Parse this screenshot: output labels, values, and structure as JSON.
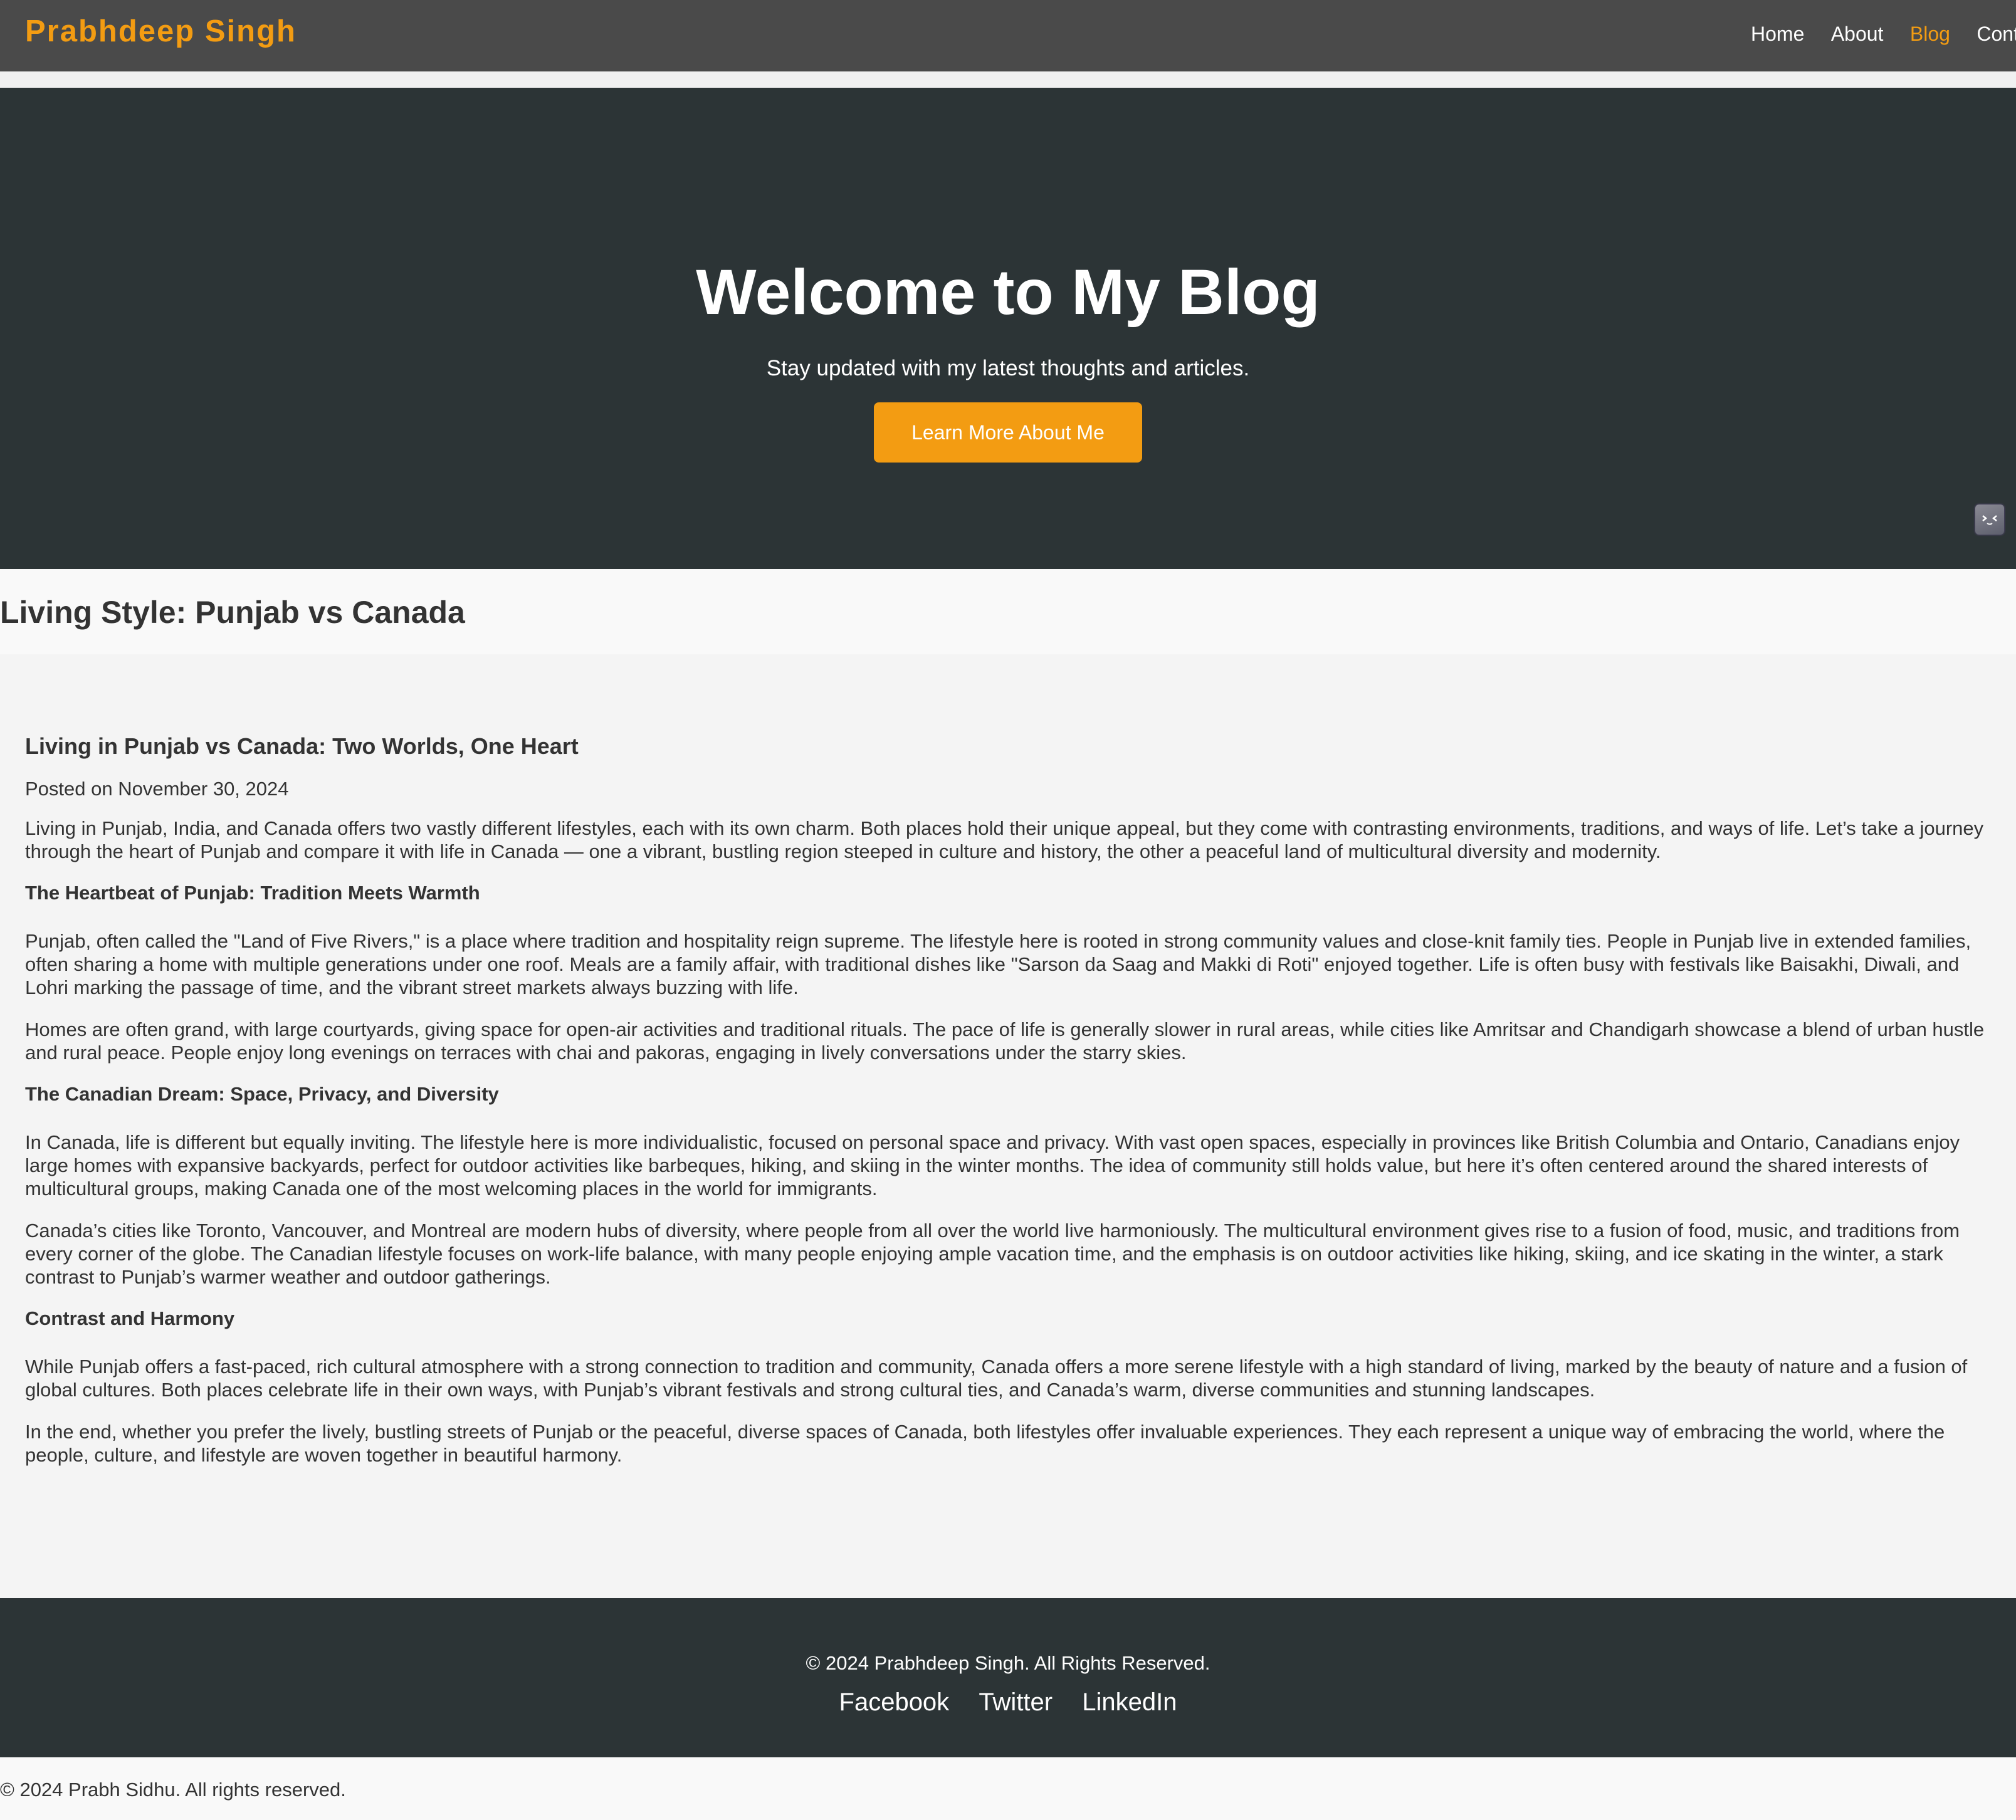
{
  "navbar": {
    "brand": "Prabhdeep Singh",
    "links": [
      "Home",
      "About",
      "Blog",
      "Contact"
    ],
    "active": "Blog",
    "accent_color": "#f39c12"
  },
  "hero": {
    "title": "Welcome to My Blog",
    "subtitle": "Stay updated with my latest thoughts and articles.",
    "button_label": "Learn More About Me"
  },
  "page": {
    "title": "Living Style: Punjab vs Canada"
  },
  "article": {
    "title": "Living in Punjab vs Canada: Two Worlds, One Heart",
    "date": "Posted on November 30, 2024",
    "intro": "Living in Punjab, India, and Canada offers two vastly different lifestyles, each with its own charm. Both places hold their unique appeal, but they come with contrasting environments, traditions, and ways of life. Let’s take a journey through the heart of Punjab and compare it with life in Canada — one a vibrant, bustling region steeped in culture and history, the other a peaceful land of multicultural diversity and modernity.",
    "sections": [
      {
        "heading": "The Heartbeat of Punjab: Tradition Meets Warmth",
        "paragraphs": [
          "Punjab, often called the \"Land of Five Rivers,\" is a place where tradition and hospitality reign supreme. The lifestyle here is rooted in strong community values and close-knit family ties. People in Punjab live in extended families, often sharing a home with multiple generations under one roof. Meals are a family affair, with traditional dishes like \"Sarson da Saag and Makki di Roti\" enjoyed together. Life is often busy with festivals like Baisakhi, Diwali, and Lohri marking the passage of time, and the vibrant street markets always buzzing with life.",
          "Homes are often grand, with large courtyards, giving space for open-air activities and traditional rituals. The pace of life is generally slower in rural areas, while cities like Amritsar and Chandigarh showcase a blend of urban hustle and rural peace. People enjoy long evenings on terraces with chai and pakoras, engaging in lively conversations under the starry skies."
        ]
      },
      {
        "heading": "The Canadian Dream: Space, Privacy, and Diversity",
        "paragraphs": [
          "In Canada, life is different but equally inviting. The lifestyle here is more individualistic, focused on personal space and privacy. With vast open spaces, especially in provinces like British Columbia and Ontario, Canadians enjoy large homes with expansive backyards, perfect for outdoor activities like barbeques, hiking, and skiing in the winter months. The idea of community still holds value, but here it’s often centered around the shared interests of multicultural groups, making Canada one of the most welcoming places in the world for immigrants.",
          "Canada’s cities like Toronto, Vancouver, and Montreal are modern hubs of diversity, where people from all over the world live harmoniously. The multicultural environment gives rise to a fusion of food, music, and traditions from every corner of the globe. The Canadian lifestyle focuses on work-life balance, with many people enjoying ample vacation time, and the emphasis is on outdoor activities like hiking, skiing, and ice skating in the winter, a stark contrast to Punjab’s warmer weather and outdoor gatherings."
        ]
      },
      {
        "heading": "Contrast and Harmony",
        "paragraphs": [
          "While Punjab offers a fast-paced, rich cultural atmosphere with a strong connection to tradition and community, Canada offers a more serene lifestyle with a high standard of living, marked by the beauty of nature and a fusion of global cultures. Both places celebrate life in their own ways, with Punjab’s vibrant festivals and strong cultural ties, and Canada’s warm, diverse communities and stunning landscapes.",
          "In the end, whether you prefer the lively, bustling streets of Punjab or the peaceful, diverse spaces of Canada, both lifestyles offer invaluable experiences. They each represent a unique way of embracing the world, where the people, culture, and lifestyle are woven together in beautiful harmony."
        ]
      }
    ]
  },
  "footer": {
    "copyright": "© 2024 Prabhdeep Singh. All Rights Reserved.",
    "social_links": [
      "Facebook",
      "Twitter",
      "LinkedIn"
    ]
  },
  "bottom_bar": {
    "copyright": "© 2024 Prabh Sidhu. All rights reserved."
  },
  "floating_widget": {
    "icon": "extension-icon"
  }
}
